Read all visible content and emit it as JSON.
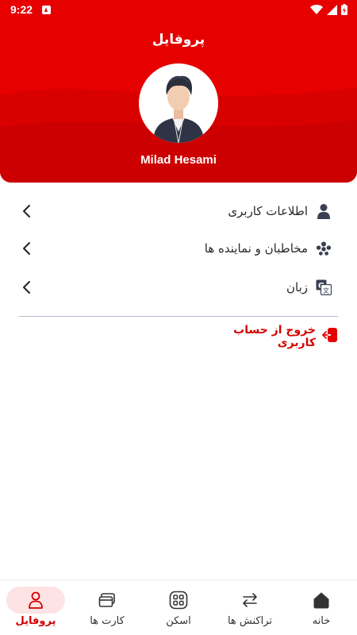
{
  "status_bar": {
    "time": "9:22"
  },
  "header": {
    "title": "پروفایل",
    "user_name": "Milad Hesami"
  },
  "menu": [
    {
      "label": "اطلاعات کاربری",
      "icon": "user-icon"
    },
    {
      "label": "مخاطبان و نماینده ها",
      "icon": "contacts-icon"
    },
    {
      "label": "زبان",
      "icon": "translate-icon"
    }
  ],
  "logout": {
    "label": "خروج از حساب کاربری",
    "icon": "logout-icon"
  },
  "bottom_nav": [
    {
      "label": "خانه",
      "icon": "home-icon",
      "active": false
    },
    {
      "label": "تراکنش ها",
      "icon": "transactions-icon",
      "active": false
    },
    {
      "label": "اسکن",
      "icon": "scan-icon",
      "active": false
    },
    {
      "label": "کارت ها",
      "icon": "cards-icon",
      "active": false
    },
    {
      "label": "پروفایل",
      "icon": "profile-icon",
      "active": true
    }
  ],
  "colors": {
    "brand_red": "#e60000",
    "accent_text": "#d40000",
    "active_pill": "#fde3e3"
  }
}
